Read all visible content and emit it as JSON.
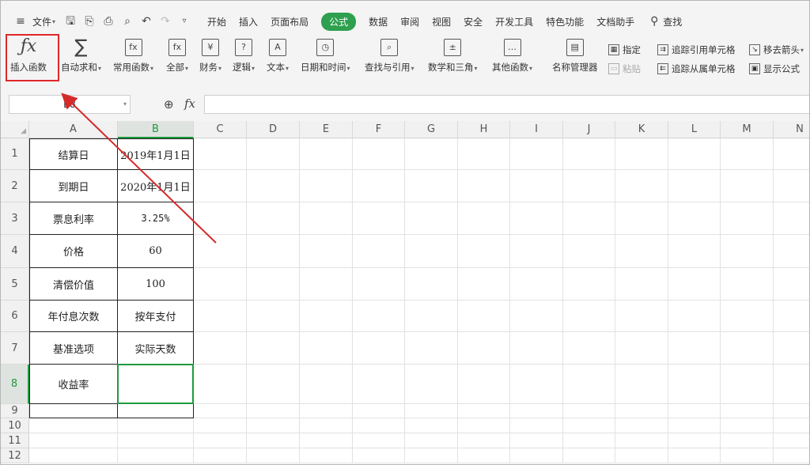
{
  "menu": {
    "file_label": "文件",
    "tabs": [
      "开始",
      "插入",
      "页面布局",
      "公式",
      "数据",
      "审阅",
      "视图",
      "安全",
      "开发工具",
      "特色功能",
      "文档助手"
    ],
    "active_tab": "公式",
    "search_label": "查找"
  },
  "ribbon": {
    "insert_function": "插入函数",
    "autosum": "自动求和",
    "common_functions": "常用函数",
    "all": "全部",
    "finance": "财务",
    "logic": "逻辑",
    "text": "文本",
    "datetime": "日期和时间",
    "lookup": "查找与引用",
    "math": "数学和三角",
    "other": "其他函数",
    "name_manager": "名称管理器",
    "specify": "指定",
    "paste": "粘贴",
    "trace_precedents": "追踪引用单元格",
    "trace_dependents": "追踪从属单元格",
    "remove_arrows": "移去箭头",
    "show_formulas": "显示公式"
  },
  "formula_bar": {
    "name_box": "B8",
    "fx_label": "fx",
    "value": ""
  },
  "columns": [
    "A",
    "B",
    "C",
    "D",
    "E",
    "F",
    "G",
    "H",
    "I",
    "J",
    "K",
    "L",
    "M",
    "N"
  ],
  "rows": [
    "1",
    "2",
    "3",
    "4",
    "5",
    "6",
    "7",
    "8",
    "9",
    "10",
    "11",
    "12"
  ],
  "table": [
    {
      "label": "结算日",
      "value": "2019年1月1日"
    },
    {
      "label": "到期日",
      "value": "2020年1月1日"
    },
    {
      "label": "票息利率",
      "value": "3.25%"
    },
    {
      "label": "价格",
      "value": "60"
    },
    {
      "label": "清偿价值",
      "value": "100"
    },
    {
      "label": "年付息次数",
      "value": "按年支付"
    },
    {
      "label": "基准选项",
      "value": "实际天数"
    },
    {
      "label": "收益率",
      "value": ""
    }
  ],
  "colors": {
    "accent": "#2ea04f",
    "highlight": "#e0272a",
    "selection": "#1e9a3f"
  }
}
